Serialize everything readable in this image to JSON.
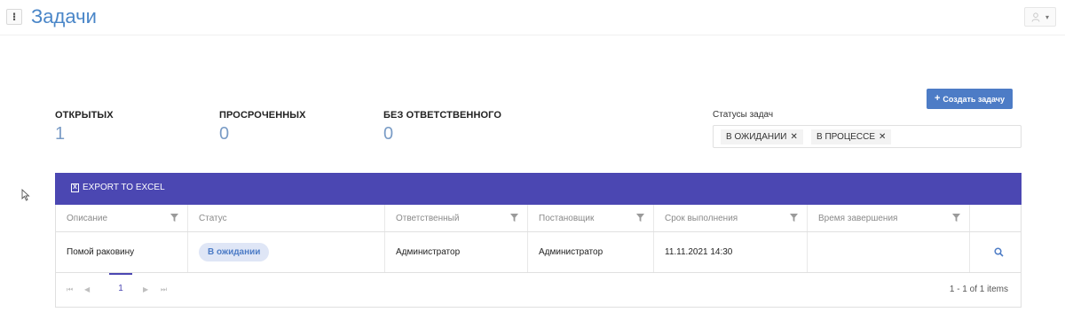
{
  "header": {
    "title": "Задачи",
    "menu_glyph": "⁝",
    "user_icon": "user-icon"
  },
  "stats": {
    "open_label": "ОТКРЫТЫХ",
    "open_value": "1",
    "overdue_label": "ПРОСРОЧЕННЫХ",
    "overdue_value": "0",
    "unassigned_label": "БЕЗ ОТВЕТСТВЕННОГО",
    "unassigned_value": "0"
  },
  "create_button": {
    "icon": "+",
    "label": "Создать задачу"
  },
  "status_filter": {
    "label": "Статусы задач",
    "chips": [
      "В ОЖИДАНИИ",
      "В ПРОЦЕССЕ"
    ]
  },
  "toolbar": {
    "export_label": "EXPORT TO EXCEL",
    "export_icon": "X"
  },
  "table": {
    "columns": [
      "Описание",
      "Статус",
      "Ответственный",
      "Постановщик",
      "Срок выполнения",
      "Время завершения"
    ],
    "rows": [
      {
        "description": "Помой раковину",
        "status": "В ожидании",
        "assignee": "Администратор",
        "creator": "Администратор",
        "due": "11.11.2021 14:30",
        "completed": ""
      }
    ]
  },
  "pager": {
    "first": "⏮",
    "prev": "◀",
    "page": "1",
    "next": "▶",
    "last": "⏭",
    "info": "1 - 1 of 1 items"
  },
  "colors": {
    "title_blue": "#4a86c8",
    "toolbar_purple": "#4b47b2",
    "button_blue": "#4d7cc6",
    "stat_value": "#7a9cc6",
    "badge_bg": "#dfe6f6"
  }
}
